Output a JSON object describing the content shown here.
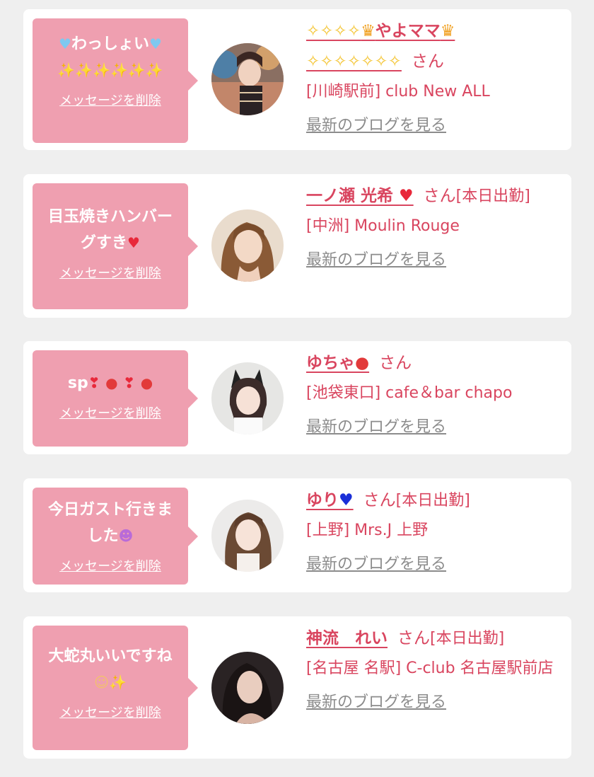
{
  "colors": {
    "background": "#efefef",
    "card": "#ffffff",
    "bubble": "#ef9fb0",
    "accent": "#d9455f",
    "blog_link": "#8c8c8c"
  },
  "delete_label": "メッセージを削除",
  "blog_label": "最新のブログを見る",
  "san_suffix": "さん",
  "messages": [
    {
      "message_text": "わっしょい",
      "message_icons": [
        "light-blue-heart",
        "sparkles"
      ],
      "name": "やよママ",
      "name_icons": [
        "sparkles",
        "crown"
      ],
      "status": "",
      "shop": "[川崎駅前] club New ALL"
    },
    {
      "message_text": "目玉焼きハンバーグすき",
      "message_icons": [
        "red-heart"
      ],
      "name": "一ノ瀬 光希",
      "name_icons": [
        "red-heart"
      ],
      "status": "[本日出勤]",
      "shop": "[中洲] Moulin Rouge"
    },
    {
      "message_text": "sp",
      "message_icons": [
        "two-hearts",
        "strawberry"
      ],
      "name": "ゆちゃ",
      "name_icons": [
        "strawberry"
      ],
      "status": "",
      "shop": "[池袋東口] cafe＆bar chapo"
    },
    {
      "message_text": "今日ガスト行きました",
      "message_icons": [
        "smiling-face-with-horns"
      ],
      "name": "ゆり",
      "name_icons": [
        "blue-heart"
      ],
      "status": "[本日出勤]",
      "shop": "[上野] Mrs.J 上野"
    },
    {
      "message_text": "大蛇丸いいですね",
      "message_icons": [
        "pleading-face",
        "sparkles"
      ],
      "name": "神流　れい",
      "name_icons": [],
      "status": "[本日出勤]",
      "shop": "[名古屋 名駅] C-club 名古屋駅前店"
    }
  ]
}
